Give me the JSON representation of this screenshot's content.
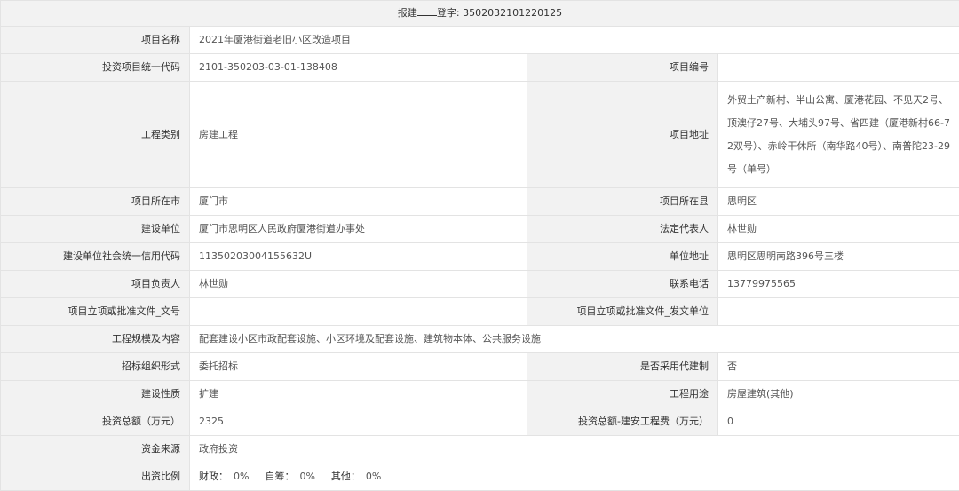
{
  "header": {
    "prefix": "报建",
    "reg_label": "登字: 3502032101220125"
  },
  "rows": {
    "project_name": {
      "label": "项目名称",
      "value": "2021年厦港街道老旧小区改造项目"
    },
    "invest_code": {
      "label": "投资项目统一代码",
      "value": "2101-350203-03-01-138408"
    },
    "project_no": {
      "label": "项目编号",
      "value": ""
    },
    "project_type": {
      "label": "工程类别",
      "value": "房建工程"
    },
    "project_address": {
      "label": "项目地址",
      "value": "外贸土产新村、半山公寓、厦港花园、不见天2号、顶澳仔27号、大埔头97号、省四建（厦港新村66-72双号）、赤岭干休所（南华路40号）、南普陀23-29号（单号）"
    },
    "city": {
      "label": "项目所在市",
      "value": "厦门市"
    },
    "county": {
      "label": "项目所在县",
      "value": "思明区"
    },
    "builder": {
      "label": "建设单位",
      "value": "厦门市思明区人民政府厦港街道办事处"
    },
    "legal_rep": {
      "label": "法定代表人",
      "value": "林世勋"
    },
    "credit_code": {
      "label": "建设单位社会统一信用代码",
      "value": "11350203004155632U"
    },
    "unit_address": {
      "label": "单位地址",
      "value": "思明区思明南路396号三楼"
    },
    "manager": {
      "label": "项目负责人",
      "value": "林世勋"
    },
    "phone": {
      "label": "联系电话",
      "value": "13779975565"
    },
    "approval_doc": {
      "label": "项目立项或批准文件_文号",
      "value": ""
    },
    "approval_unit": {
      "label": "项目立项或批准文件_发文单位",
      "value": ""
    },
    "scale": {
      "label": "工程规模及内容",
      "value": "配套建设小区市政配套设施、小区环境及配套设施、建筑物本体、公共服务设施"
    },
    "bidding": {
      "label": "招标组织形式",
      "value": "委托招标"
    },
    "agent_system": {
      "label": "是否采用代建制",
      "value": "否"
    },
    "nature": {
      "label": "建设性质",
      "value": "扩建"
    },
    "usage": {
      "label": "工程用途",
      "value": "房屋建筑(其他)"
    },
    "total_invest": {
      "label": "投资总额（万元）",
      "value": "2325"
    },
    "install_cost": {
      "label": "投资总额-建安工程费（万元）",
      "value": "0"
    },
    "fund_source": {
      "label": "资金来源",
      "value": "政府投资"
    },
    "ratio": {
      "label": "出资比例",
      "finance_label": "财政：",
      "finance_value": "0%",
      "self_label": "自筹：",
      "self_value": "0%",
      "other_label": "其他：",
      "other_value": "0%"
    }
  }
}
